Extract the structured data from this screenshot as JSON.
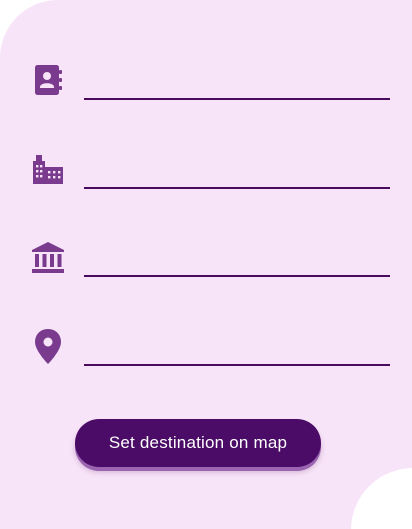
{
  "colors": {
    "card_background": "#f8e4f8",
    "icon": "#7a3b8f",
    "field_underline": "#4a0a5e",
    "button_background": "#4a0c66",
    "button_text": "#ffffff"
  },
  "fields": [
    {
      "icon": "contact-book-icon",
      "value": "",
      "placeholder": ""
    },
    {
      "icon": "city-buildings-icon",
      "value": "",
      "placeholder": ""
    },
    {
      "icon": "bank-institution-icon",
      "value": "",
      "placeholder": ""
    },
    {
      "icon": "location-pin-icon",
      "value": "",
      "placeholder": ""
    }
  ],
  "actions": {
    "set_destination_label": "Set destination on map"
  }
}
